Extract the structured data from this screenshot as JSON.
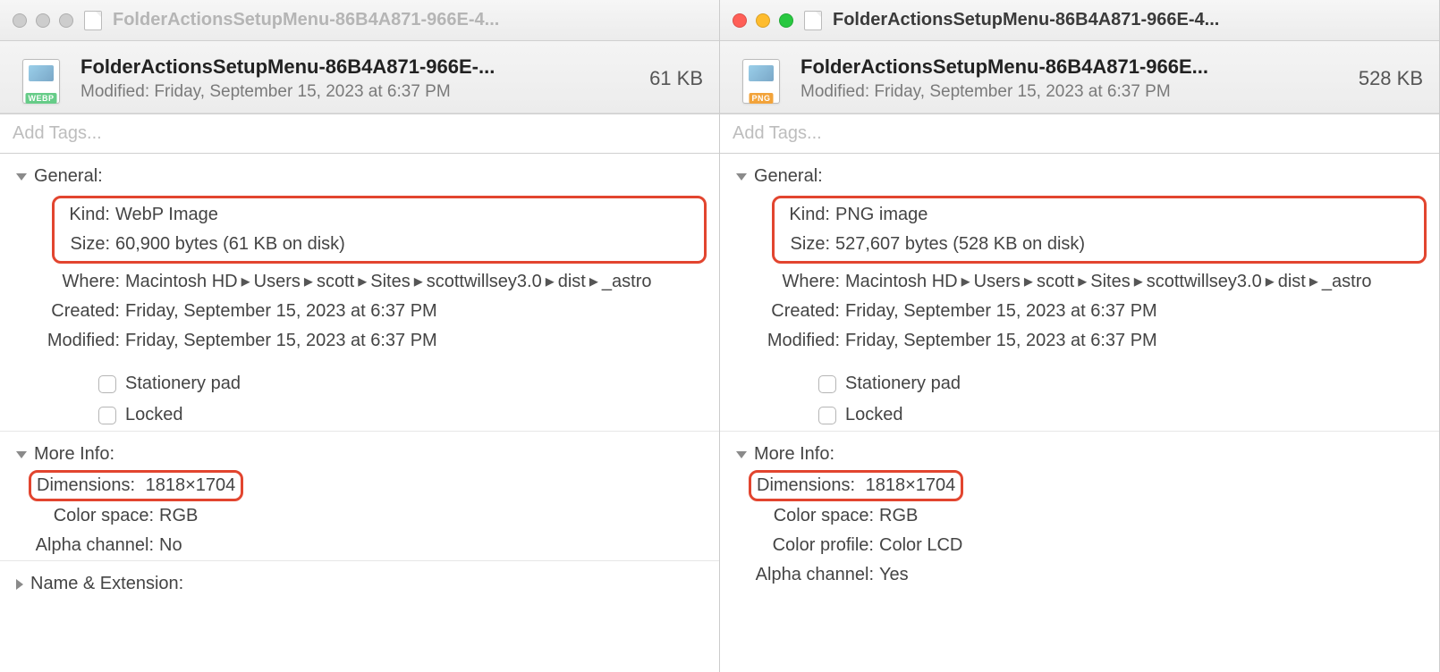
{
  "left": {
    "titlebar": "FolderActionsSetupMenu-86B4A871-966E-4...",
    "header_name": "FolderActionsSetupMenu-86B4A871-966E-...",
    "header_size": "61 KB",
    "header_modified_label": "Modified:",
    "header_modified_value": "Friday, September 15, 2023 at 6:37 PM",
    "tags_placeholder": "Add Tags...",
    "icon_badge": "WEBP",
    "sections": {
      "general_label": "General:",
      "kind_label": "Kind:",
      "kind_value": "WebP Image",
      "size_label": "Size:",
      "size_value": "60,900 bytes (61 KB on disk)",
      "where_label": "Where:",
      "where_segments": [
        "Macintosh HD",
        "Users",
        "scott",
        "Sites",
        "scottwillsey3.0",
        "dist",
        "_astro"
      ],
      "created_label": "Created:",
      "created_value": "Friday, September 15, 2023 at 6:37 PM",
      "modified_label": "Modified:",
      "modified_value": "Friday, September 15, 2023 at 6:37 PM",
      "stationery_label": "Stationery pad",
      "locked_label": "Locked",
      "moreinfo_label": "More Info:",
      "dimensions_label": "Dimensions:",
      "dimensions_value": "1818×1704",
      "colorspace_label": "Color space:",
      "colorspace_value": "RGB",
      "alpha_label": "Alpha channel:",
      "alpha_value": "No",
      "name_ext_label": "Name & Extension:"
    }
  },
  "right": {
    "titlebar": "FolderActionsSetupMenu-86B4A871-966E-4...",
    "header_name": "FolderActionsSetupMenu-86B4A871-966E...",
    "header_size": "528 KB",
    "header_modified_label": "Modified:",
    "header_modified_value": "Friday, September 15, 2023 at 6:37 PM",
    "tags_placeholder": "Add Tags...",
    "icon_badge": "PNG",
    "sections": {
      "general_label": "General:",
      "kind_label": "Kind:",
      "kind_value": "PNG image",
      "size_label": "Size:",
      "size_value": "527,607 bytes (528 KB on disk)",
      "where_label": "Where:",
      "where_segments": [
        "Macintosh HD",
        "Users",
        "scott",
        "Sites",
        "scottwillsey3.0",
        "dist",
        "_astro"
      ],
      "created_label": "Created:",
      "created_value": "Friday, September 15, 2023 at 6:37 PM",
      "modified_label": "Modified:",
      "modified_value": "Friday, September 15, 2023 at 6:37 PM",
      "stationery_label": "Stationery pad",
      "locked_label": "Locked",
      "moreinfo_label": "More Info:",
      "dimensions_label": "Dimensions:",
      "dimensions_value": "1818×1704",
      "colorspace_label": "Color space:",
      "colorspace_value": "RGB",
      "colorprofile_label": "Color profile:",
      "colorprofile_value": "Color LCD",
      "alpha_label": "Alpha channel:",
      "alpha_value": "Yes"
    }
  }
}
